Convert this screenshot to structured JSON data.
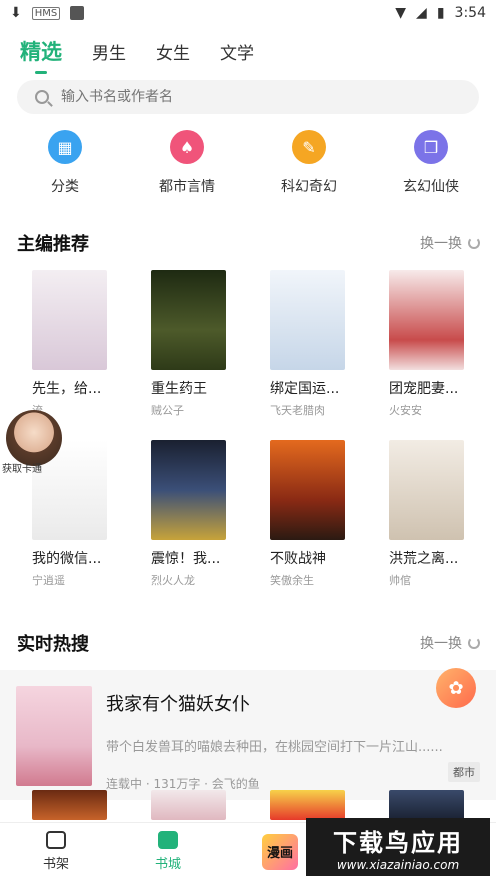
{
  "status": {
    "time": "3:54"
  },
  "tabs": [
    "精选",
    "男生",
    "女生",
    "文学"
  ],
  "search": {
    "placeholder": "输入书名或作者名"
  },
  "categories": [
    {
      "label": "分类",
      "icon": "grid-icon",
      "color": "#3aa3f0"
    },
    {
      "label": "都市言情",
      "icon": "high-heel-icon",
      "color": "#f0547a"
    },
    {
      "label": "科幻奇幻",
      "icon": "sword-icon",
      "color": "#f5a623"
    },
    {
      "label": "玄幻仙侠",
      "icon": "book-icon",
      "color": "#7b73e8"
    }
  ],
  "editor_section": {
    "title": "主编推荐",
    "more": "换一换",
    "books": [
      {
        "title": "先生，给...",
        "author": "流",
        "cover": "#e9e3ea"
      },
      {
        "title": "重生药王",
        "author": "贼公子",
        "cover": "#3f4a28"
      },
      {
        "title": "绑定国运...",
        "author": "飞天老腊肉",
        "cover": "#e4edf5"
      },
      {
        "title": "团宠肥妻...",
        "author": "火安安",
        "cover": "#f2dede"
      },
      {
        "title": "我的微信...",
        "author": "宁逍遥",
        "cover": "#f6f6f6"
      },
      {
        "title": "震惊！我...",
        "author": "烈火人龙",
        "cover": "#2a2f3b"
      },
      {
        "title": "不败战神",
        "author": "笑傲余生",
        "cover": "#8a2a14"
      },
      {
        "title": "洪荒之离...",
        "author": "帅倌",
        "cover": "#e7dfd4"
      }
    ]
  },
  "hot_section": {
    "title": "实时热搜",
    "more": "换一换",
    "book": {
      "title": "我家有个猫妖女仆",
      "desc": "带个白发兽耳的喵娘去种田，在桃园空间打下一片江山......",
      "meta": "连载中 · 131万字 · 会飞的鱼",
      "tag": "都市"
    }
  },
  "float_avatar_caption": "获取卡通",
  "nav": [
    "书架",
    "书城",
    "漫画"
  ],
  "watermark": {
    "line1": "下载鸟应用",
    "line2": "www.xiazainiao.com"
  }
}
